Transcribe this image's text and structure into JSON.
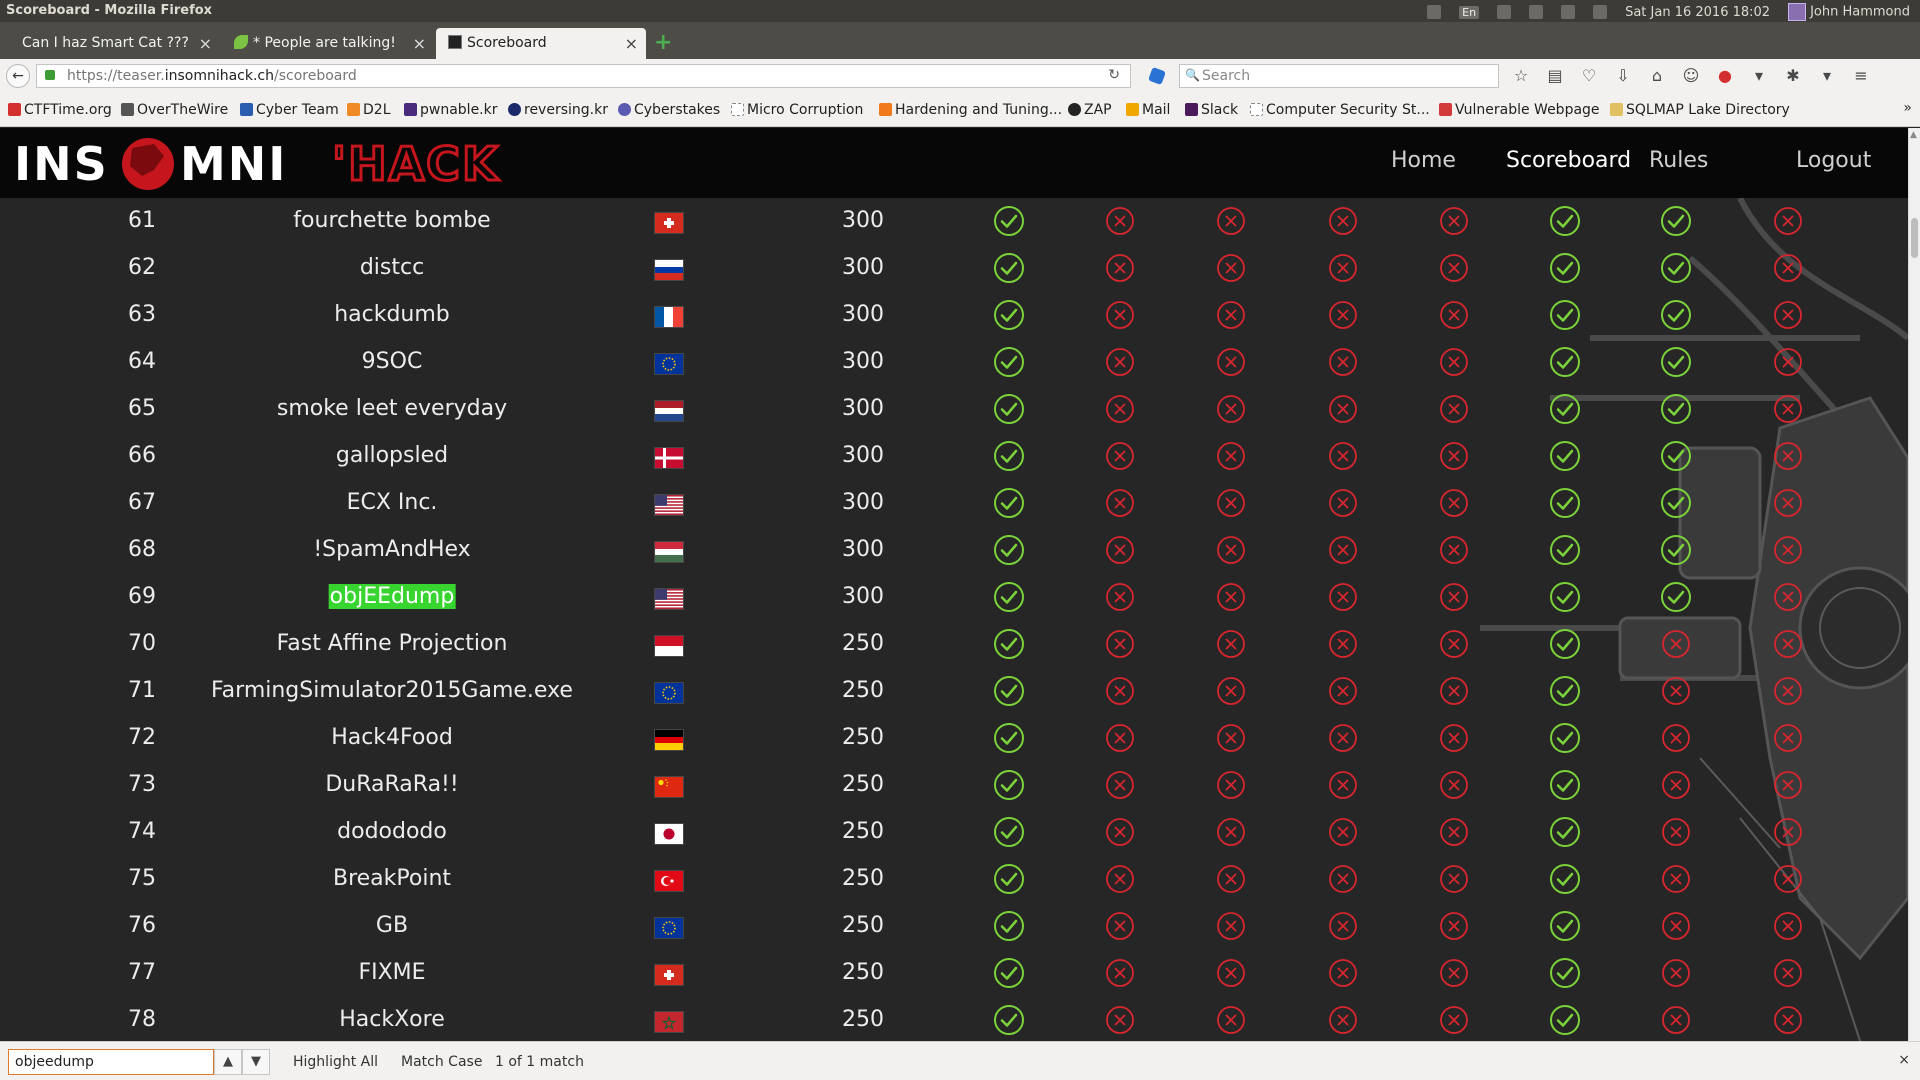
{
  "os": {
    "window_title": "Scoreboard - Mozilla Firefox",
    "keyboard_layout": "En",
    "datetime": "Sat Jan 16 2016 18:02",
    "user": "John Hammond"
  },
  "tabs": [
    {
      "label": "Can I haz Smart Cat ???",
      "close": "×"
    },
    {
      "label": "* People are talking!",
      "close": "×"
    },
    {
      "label": "Scoreboard",
      "close": "×",
      "active": true
    }
  ],
  "new_tab_label": "+",
  "nav": {
    "back": "←",
    "url_prefix": "https://teaser.",
    "url_host": "insomnihack.ch",
    "url_path": "/scoreboard",
    "reload": "↻",
    "search_placeholder": "Search"
  },
  "bookmarks": [
    {
      "label": "CTFTime.org",
      "color": "#d32f2f"
    },
    {
      "label": "OverTheWire",
      "color": "#555555"
    },
    {
      "label": "Cyber Team",
      "color": "#2a5db0"
    },
    {
      "label": "D2L",
      "color": "#f08a24"
    },
    {
      "label": "pwnable.kr",
      "color": "#4a2a7a"
    },
    {
      "label": "reversing.kr",
      "color": "#1a2a6a"
    },
    {
      "label": "Cyberstakes",
      "color": "#5a5ab0"
    },
    {
      "label": "Micro Corruption",
      "color": "#ffffff"
    },
    {
      "label": "Hardening and Tuning...",
      "color": "#f07a1a"
    },
    {
      "label": "ZAP",
      "color": "#222222"
    },
    {
      "label": "Mail",
      "color": "#f0a800"
    },
    {
      "label": "Slack",
      "color": "#4a1a5a"
    },
    {
      "label": "Computer Security St...",
      "color": "#ffffff"
    },
    {
      "label": "Vulnerable Webpage",
      "color": "#d33a3a"
    },
    {
      "label": "SQLMAP Lake Directory",
      "color": "#e0c060"
    }
  ],
  "bookmarks_more": "»",
  "site": {
    "nav": [
      "Home",
      "Scoreboard",
      "Rules",
      "Logout"
    ],
    "logo_left": "INS",
    "logo_mid": "MNI",
    "logo_right": "'HACK"
  },
  "colors": {
    "solved": "#7bd23a",
    "unsolved": "#d7262f",
    "match_highlight": "#38d430",
    "logo_red": "#c4161c"
  },
  "flag_icons": {
    "ch": "switzerland-flag-icon",
    "ru": "russia-flag-icon",
    "fr": "france-flag-icon",
    "eu": "eu-flag-icon",
    "nl": "netherlands-flag-icon",
    "dk": "denmark-flag-icon",
    "us": "usa-flag-icon",
    "hu": "hungary-flag-icon",
    "id": "indonesia-flag-icon",
    "de": "germany-flag-icon",
    "cn": "china-flag-icon",
    "jp": "japan-flag-icon",
    "tr": "turkey-flag-icon",
    "ma": "morocco-flag-icon"
  },
  "scoreboard": {
    "rows": [
      {
        "rank": "61",
        "team": "fourchette bombe",
        "flag": "ch",
        "score": "300",
        "solved": [
          1,
          0,
          0,
          0,
          0,
          1,
          1,
          0
        ]
      },
      {
        "rank": "62",
        "team": "distcc",
        "flag": "ru",
        "score": "300",
        "solved": [
          1,
          0,
          0,
          0,
          0,
          1,
          1,
          0
        ]
      },
      {
        "rank": "63",
        "team": "hackdumb",
        "flag": "fr",
        "score": "300",
        "solved": [
          1,
          0,
          0,
          0,
          0,
          1,
          1,
          0
        ]
      },
      {
        "rank": "64",
        "team": "9SOC",
        "flag": "eu",
        "score": "300",
        "solved": [
          1,
          0,
          0,
          0,
          0,
          1,
          1,
          0
        ]
      },
      {
        "rank": "65",
        "team": "smoke leet everyday",
        "flag": "nl",
        "score": "300",
        "solved": [
          1,
          0,
          0,
          0,
          0,
          1,
          1,
          0
        ]
      },
      {
        "rank": "66",
        "team": "gallopsled",
        "flag": "dk",
        "score": "300",
        "solved": [
          1,
          0,
          0,
          0,
          0,
          1,
          1,
          0
        ]
      },
      {
        "rank": "67",
        "team": "ECX Inc.",
        "flag": "us",
        "score": "300",
        "solved": [
          1,
          0,
          0,
          0,
          0,
          1,
          1,
          0
        ]
      },
      {
        "rank": "68",
        "team": "!SpamAndHex",
        "flag": "hu",
        "score": "300",
        "solved": [
          1,
          0,
          0,
          0,
          0,
          1,
          1,
          0
        ]
      },
      {
        "rank": "69",
        "team": "objEEdump",
        "flag": "us",
        "score": "300",
        "solved": [
          1,
          0,
          0,
          0,
          0,
          1,
          1,
          0
        ],
        "highlight": true
      },
      {
        "rank": "70",
        "team": "Fast Affine Projection",
        "flag": "id",
        "score": "250",
        "solved": [
          1,
          0,
          0,
          0,
          0,
          1,
          0,
          0
        ]
      },
      {
        "rank": "71",
        "team": "FarmingSimulator2015Game.exe",
        "flag": "eu",
        "score": "250",
        "solved": [
          1,
          0,
          0,
          0,
          0,
          1,
          0,
          0
        ]
      },
      {
        "rank": "72",
        "team": "Hack4Food",
        "flag": "de",
        "score": "250",
        "solved": [
          1,
          0,
          0,
          0,
          0,
          1,
          0,
          0
        ]
      },
      {
        "rank": "73",
        "team": "DuRaRaRa!!",
        "flag": "cn",
        "score": "250",
        "solved": [
          1,
          0,
          0,
          0,
          0,
          1,
          0,
          0
        ]
      },
      {
        "rank": "74",
        "team": "dodododo",
        "flag": "jp",
        "score": "250",
        "solved": [
          1,
          0,
          0,
          0,
          0,
          1,
          0,
          0
        ]
      },
      {
        "rank": "75",
        "team": "BreakPoint",
        "flag": "tr",
        "score": "250",
        "solved": [
          1,
          0,
          0,
          0,
          0,
          1,
          0,
          0
        ]
      },
      {
        "rank": "76",
        "team": "GB",
        "flag": "eu",
        "score": "250",
        "solved": [
          1,
          0,
          0,
          0,
          0,
          1,
          0,
          0
        ]
      },
      {
        "rank": "77",
        "team": "FIXME",
        "flag": "ch",
        "score": "250",
        "solved": [
          1,
          0,
          0,
          0,
          0,
          1,
          0,
          0
        ]
      },
      {
        "rank": "78",
        "team": "HackXore",
        "flag": "ma",
        "score": "250",
        "solved": [
          1,
          0,
          0,
          0,
          0,
          1,
          0,
          0
        ]
      }
    ]
  },
  "find_bar": {
    "query": "objeedump",
    "prev": "▲",
    "next": "▼",
    "highlight_all": "Highlight All",
    "match_case": "Match Case",
    "status": "1 of 1 match",
    "close": "×"
  }
}
